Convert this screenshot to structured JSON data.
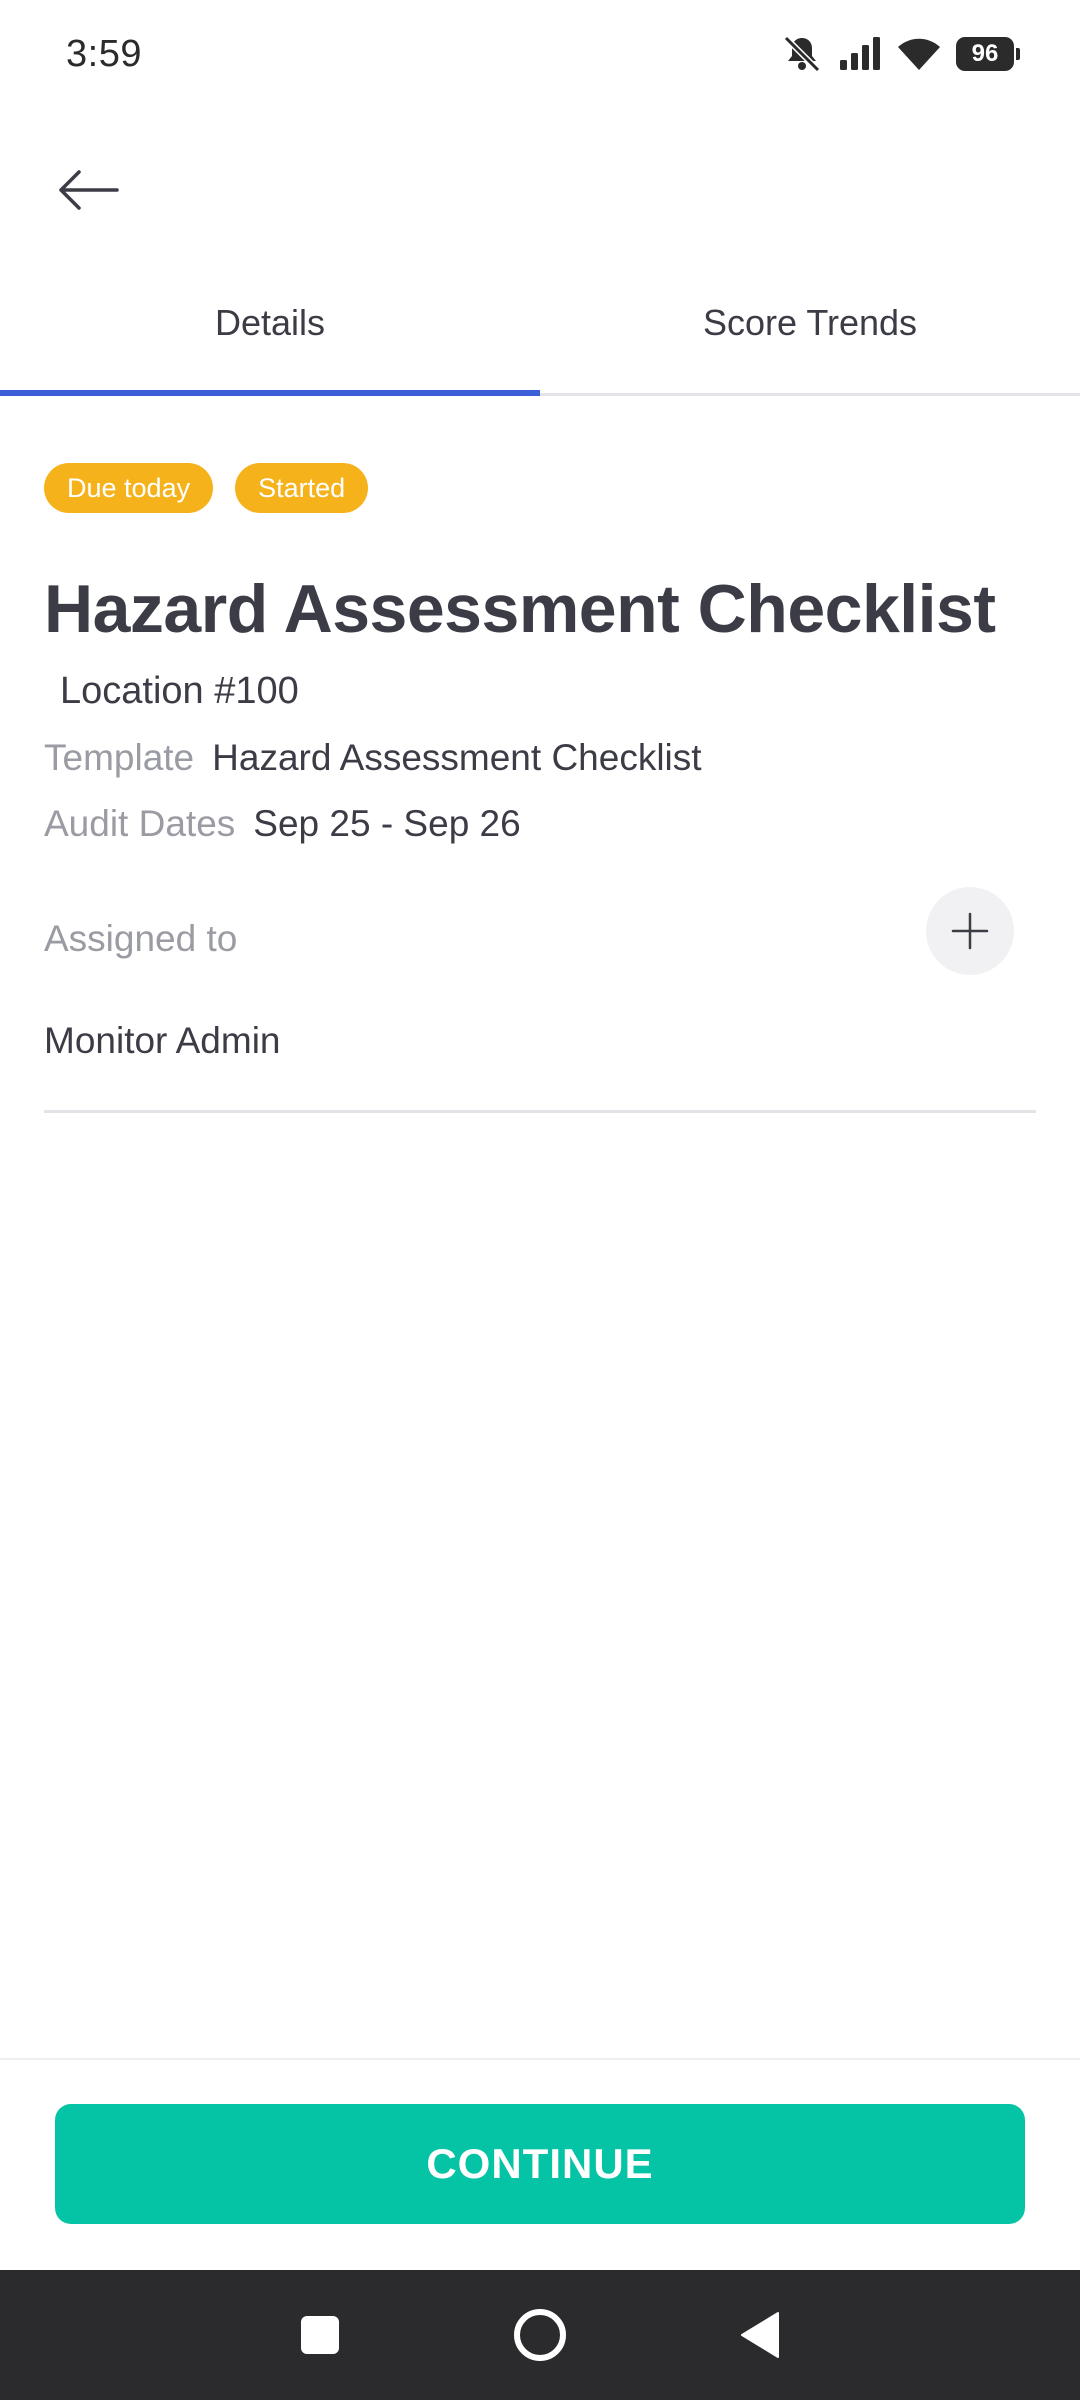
{
  "status_bar": {
    "time": "3:59",
    "battery": "96",
    "icons": [
      "notifications-off-icon",
      "signal-icon",
      "wifi-icon",
      "battery-icon"
    ]
  },
  "tabs": [
    {
      "label": "Details",
      "active": true
    },
    {
      "label": "Score Trends",
      "active": false
    }
  ],
  "badges": [
    {
      "label": "Due today",
      "color": "#f6b21a"
    },
    {
      "label": "Started",
      "color": "#f6b21a"
    }
  ],
  "audit": {
    "title": "Hazard Assessment Checklist",
    "location": "Location #100",
    "template_label": "Template",
    "template_value": "Hazard Assessment Checklist",
    "dates_label": "Audit Dates",
    "dates_value": "Sep 25 - Sep 26",
    "assigned_label": "Assigned to",
    "assignee": "Monitor Admin"
  },
  "actions": {
    "continue_label": "CONTINUE"
  },
  "colors": {
    "accent_tab": "#3b5fd6",
    "primary_button": "#05c4a6",
    "badge": "#f6b21a",
    "text_primary": "#3b3c46",
    "text_muted": "#9a9ba3"
  }
}
